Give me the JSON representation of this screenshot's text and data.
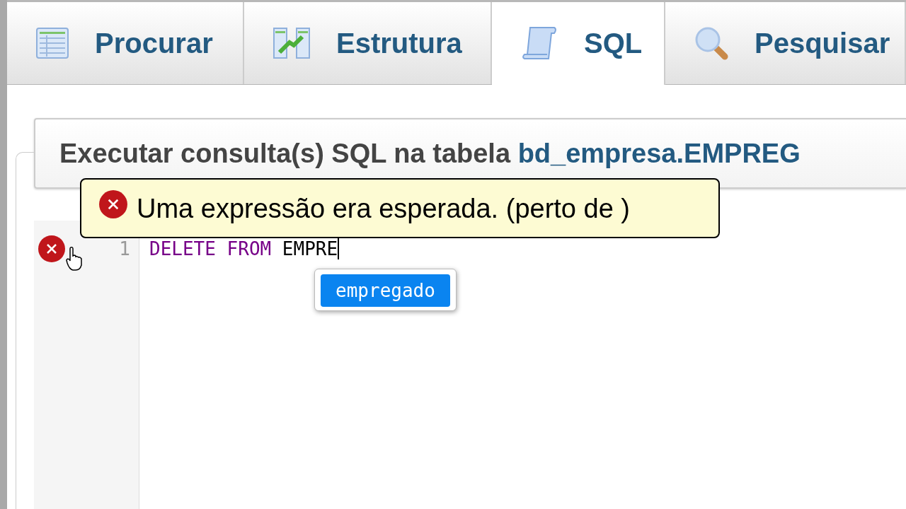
{
  "tabs": [
    {
      "label": "Procurar",
      "kind": "table",
      "selected": false
    },
    {
      "label": "Estrutura",
      "kind": "structure",
      "selected": false
    },
    {
      "label": "SQL",
      "kind": "scroll",
      "selected": true
    },
    {
      "label": "Pesquisar",
      "kind": "search",
      "selected": false
    }
  ],
  "query_box": {
    "title": "Executar consulta(s) SQL na tabela ",
    "table_link": "bd_empresa.EMPREG"
  },
  "editor": {
    "lines": [
      {
        "number": "1",
        "tokens": [
          {
            "text": "DELETE",
            "kind": "keyword"
          },
          {
            "text": "FROM",
            "kind": "keyword"
          },
          {
            "text": "EMPRE",
            "kind": "plain"
          }
        ]
      }
    ]
  },
  "tooltip": {
    "message": "Uma expressão era esperada. (perto de )"
  },
  "autocomplete": [
    {
      "label": "empregado",
      "selected": true
    }
  ]
}
